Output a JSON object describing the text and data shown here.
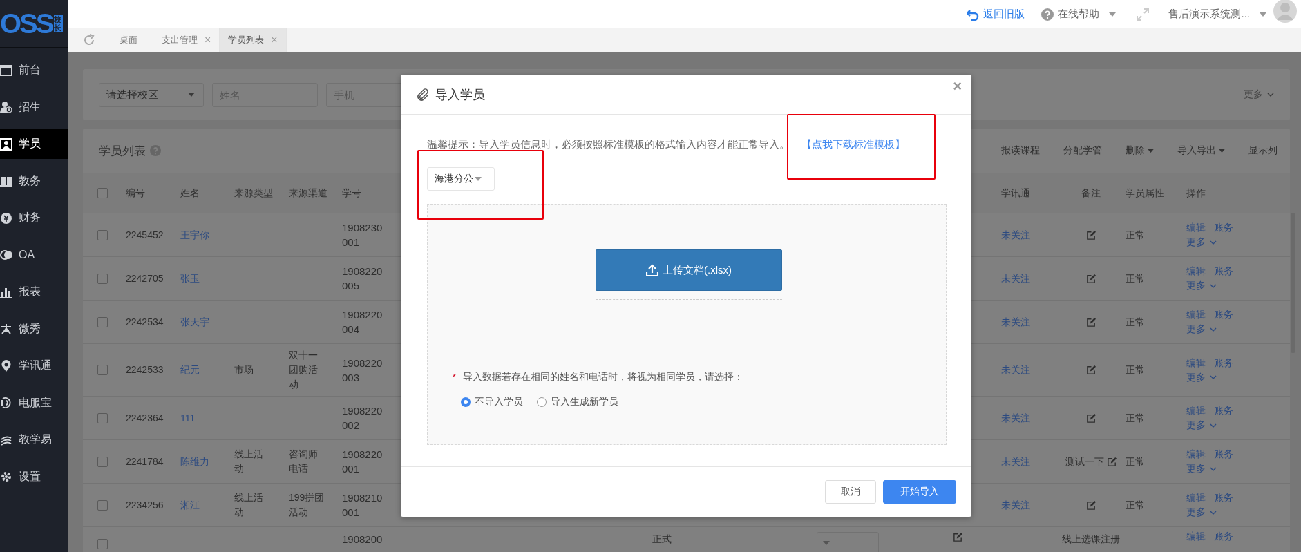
{
  "header": {
    "logo": "OSS",
    "logo_badge": "校长",
    "back_link": "返回旧版",
    "help": "在线帮助",
    "user": "售后演示系统测..."
  },
  "sidebar": {
    "items": [
      {
        "label": "前台",
        "selected": false
      },
      {
        "label": "招生",
        "selected": false
      },
      {
        "label": "学员",
        "selected": true
      },
      {
        "label": "教务",
        "selected": false
      },
      {
        "label": "财务",
        "selected": false
      },
      {
        "label": "OA",
        "selected": false
      },
      {
        "label": "报表",
        "selected": false
      },
      {
        "label": "微秀",
        "selected": false
      },
      {
        "label": "学讯通",
        "selected": false
      },
      {
        "label": "电服宝",
        "selected": false
      },
      {
        "label": "教学易",
        "selected": false
      },
      {
        "label": "设置",
        "selected": false
      }
    ]
  },
  "tabs": [
    {
      "label": "桌面",
      "selected": false
    },
    {
      "label": "支出管理",
      "close": "×",
      "selected": false
    },
    {
      "label": "学员列表",
      "close": "×",
      "selected": true
    }
  ],
  "filters": {
    "campus_select": "请选择校区",
    "name_placeholder": "姓名",
    "phone_placeholder": "手机",
    "more": "更多"
  },
  "table": {
    "title": "学员列表",
    "toolbar": [
      {
        "label": "报读课程",
        "dropdown": false
      },
      {
        "label": "分配学管",
        "dropdown": false
      },
      {
        "label": "删除",
        "dropdown": true
      },
      {
        "label": "导入导出",
        "dropdown": true
      },
      {
        "label": "显示列",
        "dropdown": false
      }
    ],
    "header_checked": false,
    "columns": [
      "编号",
      "姓名",
      "来源类型",
      "来源渠道",
      "学号",
      "学讯通",
      "备注",
      "学员属性",
      "操作"
    ],
    "rows": [
      {
        "checked": false,
        "id": "2245452",
        "name": "王宇你",
        "source_type": "",
        "source_channel": "",
        "student_no": "1908230001",
        "wechat": "未关注",
        "note": "",
        "note_edit": true,
        "attribute": "正常",
        "actions": [
          "编辑",
          "账务",
          "更多"
        ]
      },
      {
        "checked": false,
        "id": "2242705",
        "name": "张玉",
        "source_type": "",
        "source_channel": "",
        "student_no": "1908220005",
        "wechat": "未关注",
        "note": "",
        "note_edit": true,
        "attribute": "正常",
        "actions": [
          "编辑",
          "账务",
          "更多"
        ]
      },
      {
        "checked": false,
        "id": "2242534",
        "name": "张天宇",
        "source_type": "",
        "source_channel": "",
        "student_no": "1908220004",
        "wechat": "未关注",
        "note": "",
        "note_edit": true,
        "attribute": "正常",
        "actions": [
          "编辑",
          "账务",
          "更多"
        ]
      },
      {
        "checked": false,
        "id": "2242533",
        "name": "纪元",
        "source_type": "市场",
        "source_channel": "双十一团购活动",
        "student_no": "1908220003",
        "wechat": "未关注",
        "note": "",
        "note_edit": true,
        "attribute": "正常",
        "actions": [
          "编辑",
          "账务",
          "更多"
        ]
      },
      {
        "checked": false,
        "id": "2242364",
        "name": "111",
        "source_type": "",
        "source_channel": "",
        "student_no": "1908220002",
        "wechat": "未关注",
        "note": "",
        "note_edit": true,
        "attribute": "正常",
        "actions": [
          "编辑",
          "账务",
          "更多"
        ]
      },
      {
        "checked": false,
        "id": "2241784",
        "name": "陈维力",
        "source_type": "线上活动",
        "source_channel": "咨询师电话",
        "student_no": "1908220001",
        "wechat": "未关注",
        "note": "测试一下",
        "note_edit": true,
        "attribute": "正常",
        "actions": [
          "编辑",
          "账务",
          "更多"
        ]
      },
      {
        "checked": false,
        "id": "2234256",
        "name": "湘江",
        "source_type": "线上活动",
        "source_channel": "199拼团活动",
        "student_no": "1908210001",
        "wechat": "未关注",
        "note": "",
        "note_edit": true,
        "attribute": "正常",
        "actions": [
          "编辑",
          "账务",
          "更多"
        ]
      },
      {
        "checked": false,
        "source_type": "",
        "source_channel": "",
        "student_no": "1908200",
        "middle": [
          {
            "kind": "empty"
          },
          {
            "kind": "empty"
          },
          {
            "kind": "empty"
          },
          {
            "kind": "text",
            "text": "正式"
          },
          {
            "kind": "text",
            "text": "—"
          },
          {
            "kind": "empty"
          },
          {
            "kind": "select"
          },
          {
            "kind": "empty"
          },
          {
            "kind": "edit"
          }
        ],
        "note": "线上选课注册",
        "note_edit": false,
        "actions": [
          "编辑",
          "账务"
        ]
      }
    ]
  },
  "modal": {
    "title": "导入学员",
    "close": "×",
    "hint": "温馨提示：导入学员信息时，必须按照标准模板的格式输入内容才能正常导入。",
    "template_link": "【点我下载标准模板】",
    "campus_select": "海港分公",
    "upload_button": "上传文档(.xlsx)",
    "required_mark": "*",
    "question": "导入数据若存在相同的姓名和电话时，将视为相同学员，请选择：",
    "options": [
      {
        "label": "不导入学员",
        "selected": true
      },
      {
        "label": "导入生成新学员",
        "selected": false
      }
    ],
    "cancel": "取消",
    "confirm": "开始导入"
  }
}
